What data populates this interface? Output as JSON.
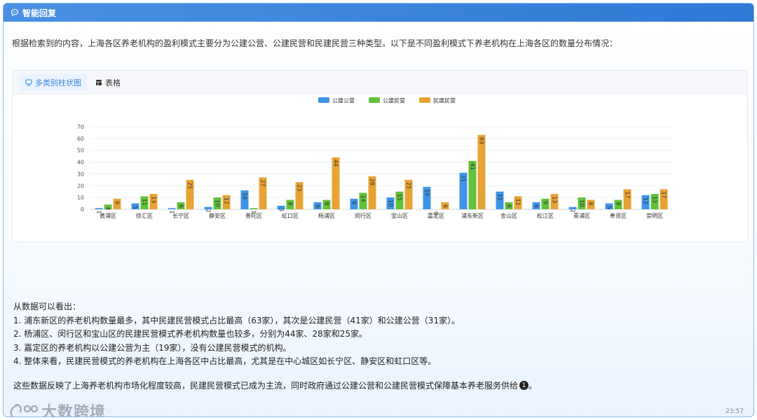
{
  "header": {
    "title": "智能回复"
  },
  "intro_text": "根据检索到的内容，上海各区养老机构的盈利模式主要分为公建公营、公建民营和民建民营三种类型。以下是不同盈利模式下养老机构在上海各区的数量分布情况：",
  "tabs": [
    {
      "label": "多类别柱状图",
      "icon": "bar-chart-icon",
      "active": true
    },
    {
      "label": "表格",
      "icon": "table-icon",
      "active": false
    }
  ],
  "chart_data": {
    "type": "bar",
    "categories": [
      "黄浦区",
      "徐汇区",
      "长宁区",
      "静安区",
      "普陀区",
      "虹口区",
      "杨浦区",
      "闵行区",
      "宝山区",
      "嘉定区",
      "浦东新区",
      "金山区",
      "松江区",
      "青浦区",
      "奉贤区",
      "崇明区"
    ],
    "series": [
      {
        "name": "公建公营",
        "color": "#3e95e8",
        "values": [
          1,
          5,
          1,
          2,
          16,
          3,
          6,
          9,
          10,
          19,
          31,
          15,
          6,
          2,
          5,
          12
        ]
      },
      {
        "name": "公建民营",
        "color": "#63c13b",
        "values": [
          4,
          11,
          6,
          10,
          1,
          8,
          8,
          14,
          15,
          0,
          41,
          6,
          9,
          10,
          8,
          13
        ]
      },
      {
        "name": "民建民营",
        "color": "#e8a335",
        "values": [
          9,
          13,
          25,
          12,
          27,
          23,
          44,
          28,
          25,
          6,
          63,
          11,
          13,
          8,
          17,
          17
        ]
      }
    ],
    "yticks": [
      0,
      10,
      20,
      30,
      40,
      50,
      60,
      70
    ],
    "ylim": [
      0,
      70
    ],
    "legend_position": "top-center",
    "grid": true
  },
  "conclusion": {
    "heading": "从数据可以看出：",
    "points": [
      "1. 浦东新区的养老机构数量最多，其中民建民营模式占比最高（63家），其次是公建民营（41家）和公建公营（31家）。",
      "2. 杨浦区、闵行区和宝山区的民建民营模式养老机构数量也较多，分别为44家、28家和25家。",
      "3. 嘉定区的养老机构以公建公营为主（19家），没有公建民营模式的机构。",
      "4. 整体来看，民建民营模式的养老机构在上海各区中占比最高，尤其是在中心城区如长宁区、静安区和虹口区等。"
    ]
  },
  "summary": {
    "text": "这些数据反映了上海养老机构市场化程度较高，民建民营模式已成为主流，同时政府通过公建公营和公建民营模式保障基本养老服务供给",
    "citation": "1"
  },
  "watermark": {
    "text": "大数跨境"
  },
  "timestamp": "23:57"
}
